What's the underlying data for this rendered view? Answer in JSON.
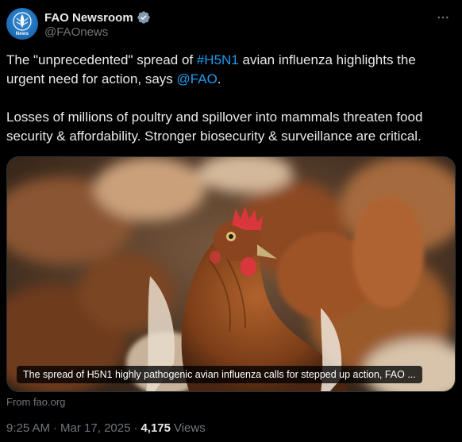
{
  "author": {
    "display_name": "FAO Newsroom",
    "handle": "@FAOnews",
    "avatar_label": "News",
    "verified": true,
    "verified_color": "#829aab"
  },
  "tweet": {
    "p1_before": "The \"unprecedented\" spread of ",
    "p1_hashtag": "#H5N1",
    "p1_middle": " avian influenza highlights the urgent need for action, says ",
    "p1_mention": "@FAO",
    "p1_after": ".",
    "p2": "Losses of millions of poultry and spillover into mammals threaten food security & affordability. Stronger biosecurity & surveillance are critical."
  },
  "media": {
    "caption": "The spread of H5N1 highly pathogenic avian influenza calls for stepped up action, FAO ...",
    "source": "From fao.org"
  },
  "meta": {
    "time": "9:25 AM",
    "separator": "·",
    "date": "Mar 17, 2025",
    "separator2": "·",
    "views_count": "4,175",
    "views_label": "Views"
  },
  "colors": {
    "background": "#000000",
    "text": "#e7e9ea",
    "muted": "#71767b",
    "link": "#1d9bf0",
    "avatar": "#1f6fb8"
  },
  "icons": {
    "more": "more-horizontal-icon",
    "verified": "verified-badge-icon"
  }
}
